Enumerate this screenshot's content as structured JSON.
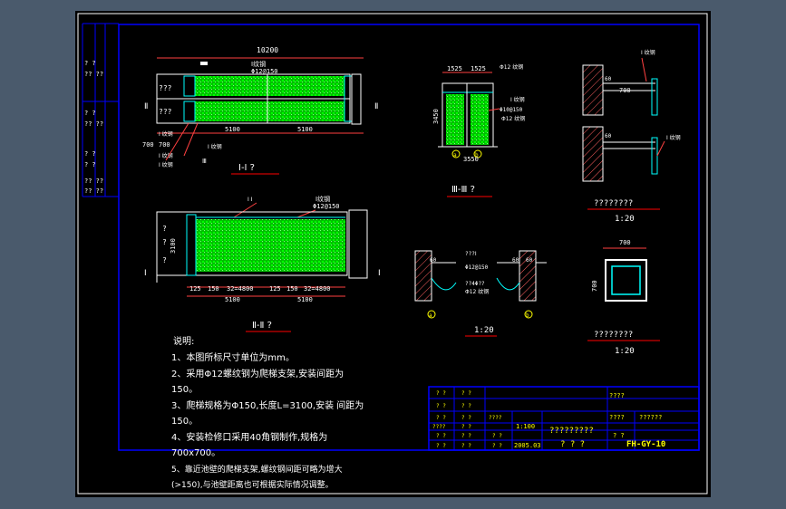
{
  "colors": {
    "background": "#000000",
    "border": "#0000ff",
    "frame": "#ffffff",
    "dimension": "#ff4040",
    "concrete": "#00ff00",
    "wall_hatch": "#ff6060",
    "leader": "#00ffff",
    "label_text": "#ffffff",
    "title_text": "#ffff00",
    "underline": "#ff0000"
  },
  "section_1": {
    "overall_dim": "10200",
    "rebar_label": "Ⅰ纹钢",
    "rebar_spec": "Φ12@150",
    "left_label_top": "???",
    "left_label_bottom": "???",
    "dim_left": "5100",
    "dim_right": "5100",
    "dim_small_a": "700",
    "dim_small_b": "700",
    "side_note_1": "Ⅰ 纹钢",
    "side_note_2": "Ⅰ 纹钢",
    "side_note_3": "Ⅰ 纹钢",
    "side_note_4": "Ⅰ 纹钢",
    "section_mark_left": "Ⅱ",
    "section_mark_right": "Ⅱ",
    "section_mark_bottom": "Ⅲ",
    "title": "Ⅰ-Ⅰ ?"
  },
  "section_2": {
    "rebar_label": "Ⅰ纹钢",
    "rebar_spec": "Φ12@150",
    "small_label": "Ⅰ Ⅰ",
    "height_dim": "3100",
    "left_q_1": "?",
    "left_q_2": "?",
    "left_q_3": "?",
    "dim_a": "125",
    "dim_b": "150",
    "dim_c": "32=4800",
    "dim_d": "125",
    "dim_e": "150",
    "dim_f": "32=4800",
    "dim_left": "5100",
    "dim_right": "5100",
    "section_mark_left": "Ⅰ",
    "section_mark_right": "Ⅰ",
    "title": "Ⅱ-Ⅱ ?"
  },
  "section_3": {
    "dim_left": "1525",
    "dim_right": "1525",
    "rebar_label": "Φ12 纹钢",
    "height_dim": "3450",
    "label_1": "Ⅰ 纹钢",
    "label_2": "Φ10@150",
    "label_3": "Φ12 纹钢",
    "bottom_dim": "3550",
    "axis_a": "a",
    "axis_b": "b",
    "title": "Ⅲ-Ⅲ ?"
  },
  "detail_top_right": {
    "label_1": "Ⅰ 纹钢",
    "label_2": "Ⅰ 纹钢",
    "dim_700": "700",
    "dim_60a": "60",
    "dim_60b": "60",
    "title": "????????",
    "scale": "1:20"
  },
  "detail_middle": {
    "dim_60a": "60",
    "dim_60b": "60",
    "dim_60c": "60",
    "rebar_1": "???Ⅰ",
    "rebar_2": "Φ12@150",
    "rebar_3": "??4Φ??",
    "rebar_4": "Φ12 纹钢",
    "axis_a": "a",
    "axis_b": "b",
    "scale": "1:20"
  },
  "detail_square": {
    "dim_top": "700",
    "dim_side": "700",
    "title": "????????",
    "scale": "1:20"
  },
  "notes": {
    "heading": "说明:",
    "line_1": "1、本图所标尺寸单位为mm。",
    "line_2": "2、采用Φ12螺纹钢为爬梯支架,安装间距为",
    "line_2b": "150。",
    "line_3": "3、爬梯规格为Φ150,长度L=3100,安装 间距为",
    "line_3b": "150。",
    "line_4": "4、安装检修口采用40角钢制作,规格为",
    "line_4b": "700x700。",
    "line_5": "5、靠近池壁的爬梯支架,螺纹钢间距可略为增大",
    "line_5b": "(>150),与池壁距离也可根据实际情况调整。"
  },
  "title_block": {
    "row_labels": [
      "? ?",
      "? ?",
      "? ?",
      "????",
      "? ?",
      "? ?"
    ],
    "col2_labels": [
      "? ?",
      "? ?",
      "? ?",
      "? ?",
      "? ?",
      "? ?"
    ],
    "mid_labels": [
      "????",
      "? ?",
      "? ?"
    ],
    "scale_value": "1:100",
    "date_value": "2005.03",
    "drawing_title": "?????????",
    "drawing_subtitle": "?  ? ?",
    "right_label_1": "????",
    "right_label_2": "????",
    "right_label_3": "??????",
    "right_label_4": "? ?",
    "drawing_number": "FH-GY-10"
  },
  "left_strip": {
    "labels": [
      "? ?",
      "?? ??",
      "? ?",
      "?? ??",
      "? ?",
      "? ?",
      "?? ??",
      "?? ??"
    ]
  }
}
